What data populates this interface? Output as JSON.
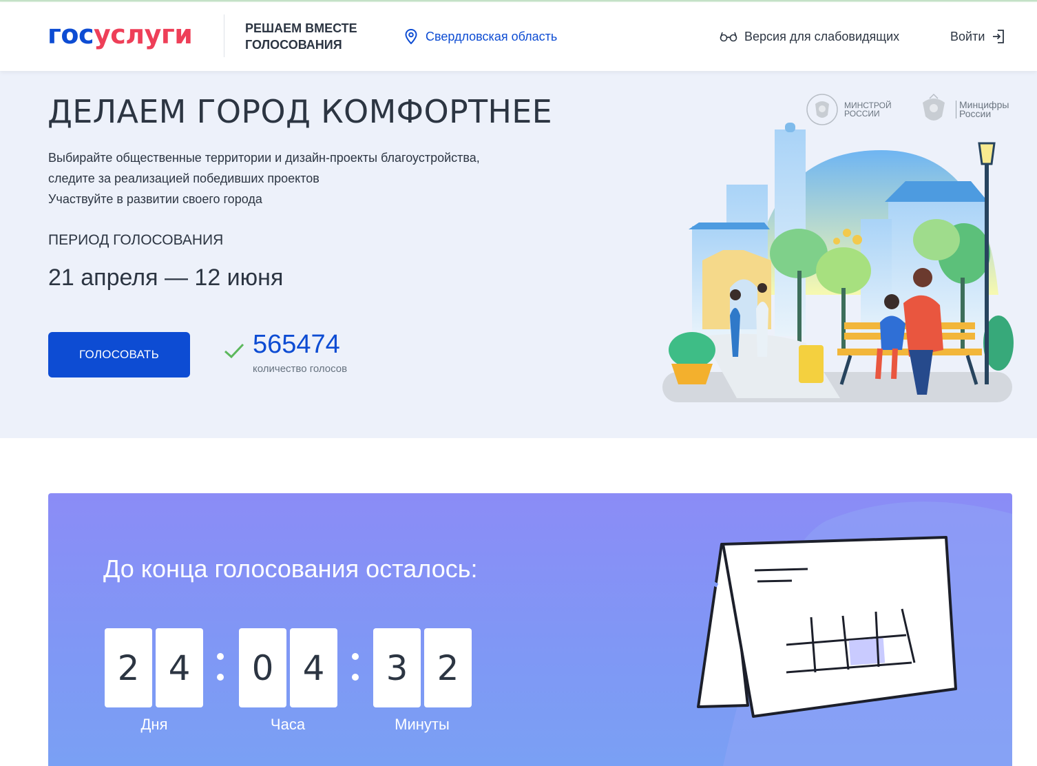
{
  "header": {
    "logo_part1": "гос",
    "logo_part2": "услуги",
    "slogan_line1": "РЕШАЕМ ВМЕСТЕ",
    "slogan_line2": "ГОЛОСОВАНИЯ",
    "region": "Свердловская область",
    "accessibility": "Версия для слабовидящих",
    "login": "Войти"
  },
  "hero": {
    "title": "ДЕЛАЕМ ГОРОД КОМФОРТНЕЕ",
    "desc_line1": "Выбирайте общественные территории и дизайн-проекты благоустройства,",
    "desc_line2": "следите за реализацией победивших проектов",
    "desc_line3": "Участвуйте в развитии своего города",
    "period_label": "ПЕРИОД ГОЛОСОВАНИЯ",
    "period_value": "21 апреля — 12 июня",
    "vote_button": "ГОЛОСОВАТЬ",
    "votes_count": "565474",
    "votes_label": "количество голосов",
    "ministry1_line1": "МИНСТРОЙ",
    "ministry1_line2": "РОССИИ",
    "ministry2_line1": "Минцифры",
    "ministry2_line2": "России"
  },
  "countdown": {
    "title": "До конца голосования осталось:",
    "digits": [
      "2",
      "4",
      "0",
      "4",
      "3",
      "2"
    ],
    "days_label": "Дня",
    "hours_label": "Часа",
    "minutes_label": "Минуты"
  },
  "colors": {
    "brand_blue": "#0d4cd3",
    "brand_red": "#ee3f58",
    "hero_bg": "#edf1fa",
    "countdown_bg": "#8b8cf6"
  }
}
